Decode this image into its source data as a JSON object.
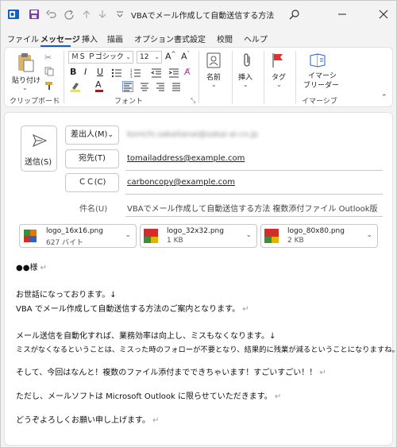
{
  "title": "VBAでメール作成して自動送信する方法 複…",
  "menu": [
    "ファイル",
    "メッセージ",
    "挿入",
    "描画",
    "オプション",
    "書式設定",
    "校閲",
    "ヘルプ"
  ],
  "ribbon": {
    "paste": "貼り付け",
    "clipboard_group": "クリップボード",
    "font_name": "ＭＳ Ｐゴシック",
    "font_size": "12",
    "font_group": "フォント",
    "names": "名前",
    "insert": "挿入",
    "tags": "タグ",
    "immersive_line1": "イマーシ",
    "immersive_line2": "ブリーダー",
    "immersive_group": "イマーシブ"
  },
  "compose": {
    "send": "送信(S)",
    "from_label": "差出人(M)",
    "from_value": "konichi.sakaitanai@sakai-ai.co.jp",
    "to_label": "宛先(T)",
    "to_value": "tomailaddress@example.com",
    "cc_label": "ＣＣ(C)",
    "cc_value": "carboncopy@example.com",
    "subject_label": "件名(U)",
    "subject_value": "VBAでメール作成して自動送信する方法 複数添付ファイル Outlook版"
  },
  "attachments": [
    {
      "name": "logo_16x16.png",
      "size": "627 バイト"
    },
    {
      "name": "logo_32x32.png",
      "size": "1 KB"
    },
    {
      "name": "logo_80x80.png",
      "size": "2 KB"
    }
  ],
  "body": [
    {
      "text": "●●様",
      "mark": " ↵"
    },
    {
      "text": "お世話になっております。↓",
      "mark": ""
    },
    {
      "text": "VBA でメール作成して自動送信する方法のご案内となります。",
      "mark": " ↵"
    },
    {
      "text": "メール送信を自動化すれば、業務効率は向上し、ミスもなくなります。↓",
      "mark": ""
    },
    {
      "text": "ミスがなくなるということは、ミスった時のフォローが不要となり、結果的に残業が減るということになりますね。",
      "mark": " ↵"
    },
    {
      "text": "そして、今回はなんと！複数のファイル添付までできちゃいます！すごいすごい！！",
      "mark": " ↵"
    },
    {
      "text": "ただし、メールソフトは Microsoft Outlook に限らせていただきます。",
      "mark": " ↵"
    },
    {
      "text": "どうぞよろしくお願い申し上げます。",
      "mark": " ↵"
    }
  ]
}
